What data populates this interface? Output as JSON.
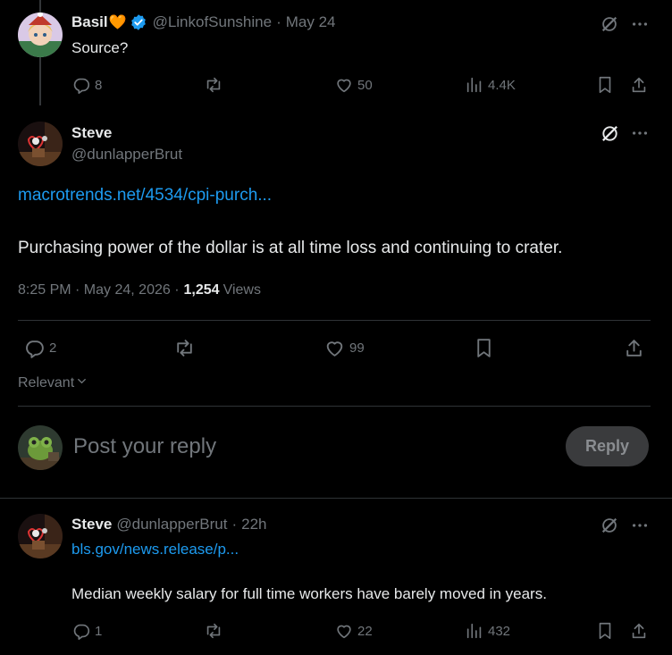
{
  "reply1": {
    "name": "Basil",
    "name_emoji": "🧡",
    "handle": "@LinkofSunshine",
    "sep": "·",
    "date": "May 24",
    "text": "Source?",
    "stats": {
      "replies": "8",
      "likes": "50",
      "views": "4.4K"
    }
  },
  "main_post": {
    "name": "Steve",
    "handle": "@dunlapperBrut",
    "link": "macrotrends.net/4534/cpi-purch...",
    "text": "Purchasing power of the dollar is at all time loss and continuing to crater.",
    "time": "8:25 PM · May 24, 2026 ·",
    "views_count": "1,254",
    "views_label": "Views",
    "stats": {
      "replies": "2",
      "likes": "99"
    }
  },
  "sort": {
    "label": "Relevant"
  },
  "composer": {
    "placeholder": "Post your reply",
    "button": "Reply"
  },
  "reply2": {
    "name": "Steve",
    "handle": "@dunlapperBrut",
    "sep": "·",
    "date": "22h",
    "link": "bls.gov/news.release/p...",
    "text": "Median weekly salary for full time workers have barely moved in years.",
    "stats": {
      "replies": "1",
      "likes": "22",
      "views": "432"
    }
  },
  "colors": {
    "accent": "#1d9bf0",
    "muted": "#71767b",
    "text": "#e7e9ea",
    "divider": "#2f3336",
    "verified": "#1d9bf0",
    "background": "#000000"
  }
}
